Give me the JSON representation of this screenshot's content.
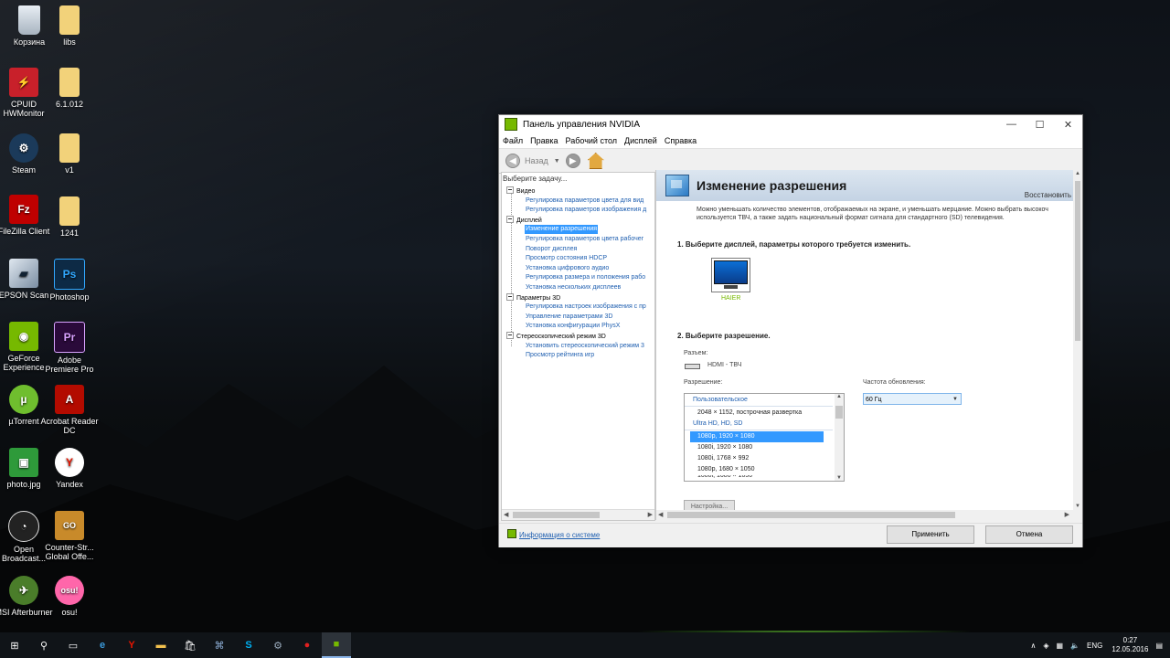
{
  "desktop": {
    "icons": [
      {
        "label": "Корзина",
        "icon": "recycle-bin-icon"
      },
      {
        "label": "libs",
        "icon": "folder-icon"
      },
      {
        "label": "CPUID HWMonitor",
        "icon": "hwmonitor-icon"
      },
      {
        "label": "6.1.012",
        "icon": "folder-icon"
      },
      {
        "label": "Steam",
        "icon": "steam-icon"
      },
      {
        "label": "v1",
        "icon": "folder-icon"
      },
      {
        "label": "FileZilla Client",
        "icon": "filezilla-icon"
      },
      {
        "label": "1241",
        "icon": "folder-icon"
      },
      {
        "label": "EPSON Scan",
        "icon": "epson-scan-icon"
      },
      {
        "label": "Photoshop",
        "icon": "photoshop-icon"
      },
      {
        "label": "GeForce Experience",
        "icon": "geforce-icon"
      },
      {
        "label": "Adobe Premiere Pro",
        "icon": "premiere-icon"
      },
      {
        "label": "µTorrent",
        "icon": "utorrent-icon"
      },
      {
        "label": "Acrobat Reader DC",
        "icon": "acrobat-icon"
      },
      {
        "label": "photo.jpg",
        "icon": "image-file-icon"
      },
      {
        "label": "Yandex",
        "icon": "yandex-icon"
      },
      {
        "label": "Open Broadcast...",
        "icon": "obs-icon"
      },
      {
        "label": "Counter-Str... Global Offe...",
        "icon": "csgo-icon"
      },
      {
        "label": "MSI Afterburner",
        "icon": "afterburner-icon"
      },
      {
        "label": "osu!",
        "icon": "osu-icon"
      }
    ]
  },
  "window": {
    "title": "Панель управления NVIDIA",
    "controls": {
      "minimize": "—",
      "maximize": "☐",
      "close": "✕"
    },
    "menu": [
      "Файл",
      "Правка",
      "Рабочий стол",
      "Дисплей",
      "Справка"
    ],
    "toolbar": {
      "back_label": "Назад"
    },
    "task_header": "Выберите задачу...",
    "tree": {
      "video": "Видео",
      "video_items": [
        "Регулировка параметров цвета для вид",
        "Регулировка параметров изображения д"
      ],
      "display": "Дисплей",
      "display_items": [
        "Изменение разрешения",
        "Регулировка параметров цвета рабочег",
        "Поворот дисплея",
        "Просмотр состояния HDCP",
        "Установка цифрового аудио",
        "Регулировка размера и положения рабо",
        "Установка нескольких дисплеев"
      ],
      "params3d": "Параметры 3D",
      "params3d_items": [
        "Регулировка настроек изображения с пр",
        "Управление параметрами 3D",
        "Установка конфигурации PhysX"
      ],
      "stereo": "Стереоскопический режим 3D",
      "stereo_items": [
        "Установить стереоскопический режим 3",
        "Просмотр рейтинга игр"
      ]
    },
    "page": {
      "title": "Изменение разрешения",
      "restore": "Восстановить",
      "description": "Можно уменьшать количество элементов, отображаемых на экране, и уменьшать мерцание. Можно выбрать высокоч используется ТВЧ, а также задать национальный формат сигнала для стандартного (SD) телевидения.",
      "step1": "1. Выберите дисплей, параметры которого требуется изменить.",
      "monitor_name": "HAIER",
      "step2": "2. Выберите разрешение.",
      "connector_label": "Разъем:",
      "connector_value": "HDMI - ТВЧ",
      "resolution_label": "Разрешение:",
      "refresh_label": "Частота обновления:",
      "refresh_value": "60 Гц",
      "customize_button": "Настройка...",
      "resolution_list": {
        "group1": "Пользовательское",
        "custom1": "2048 × 1152, построчная развертка",
        "group2": "Ultra HD, HD, SD",
        "opt1": "1080p, 1920 × 1080",
        "opt2": "1080i, 1920 × 1080",
        "opt3": "1080i, 1768 × 992",
        "opt4": "1080p, 1680 × 1050",
        "opt5": "1080i, 1680 × 1050"
      }
    },
    "footer": {
      "system_info": "Информация о системе",
      "apply": "Применить",
      "cancel": "Отмена"
    }
  },
  "taskbar": {
    "lang": "ENG",
    "time": "0:27",
    "date": "12.05.2016"
  }
}
